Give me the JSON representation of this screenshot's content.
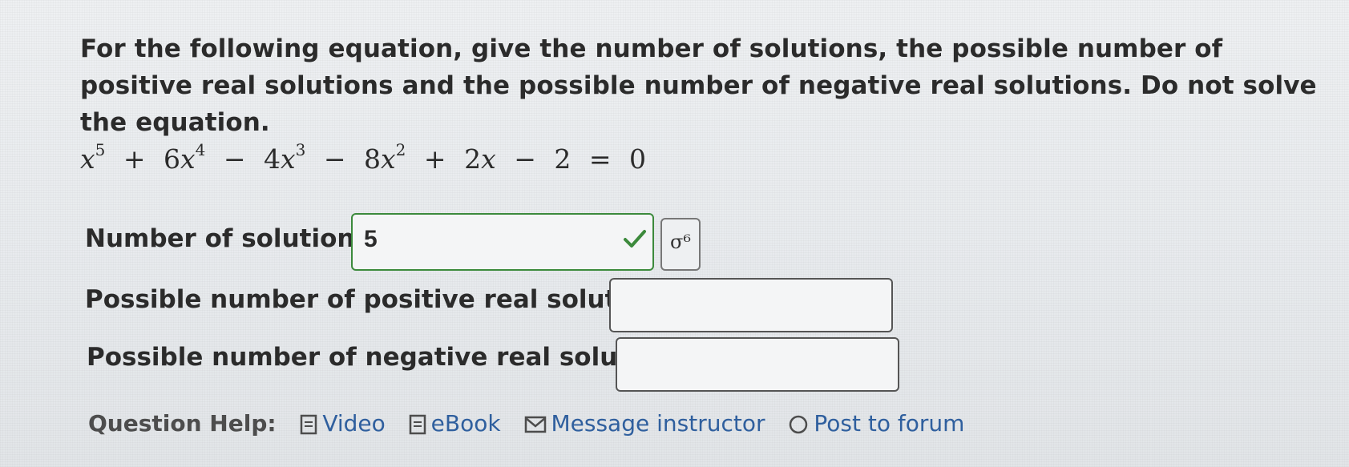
{
  "question": {
    "prompt": "For the following equation, give the number of solutions, the possible number of positive real solutions and the possible number of negative real solutions. Do not solve the equation."
  },
  "equation": {
    "x": "x",
    "exp5": "5",
    "plus1": "+",
    "coef6": "6",
    "exp4": "4",
    "minus1": "−",
    "coef4": "4",
    "exp3": "3",
    "minus2": "−",
    "coef8": "8",
    "exp2": "2",
    "plus2": "+",
    "coef2": "2",
    "minus3": "−",
    "const": "2",
    "equals": "=",
    "rhs": "0"
  },
  "fields": {
    "solutions_label": "Number of solutions:",
    "solutions_value": "5",
    "solutions_status": "correct",
    "positive_label": "Possible number of positive real solutions:",
    "positive_value": "",
    "negative_label": "Possible number of negative real solutions:",
    "negative_value": ""
  },
  "preview_button": {
    "glyph": "σ⁶"
  },
  "help": {
    "label": "Question Help:",
    "video": "Video",
    "ebook": "eBook",
    "message": "Message instructor",
    "forum": "Post to forum"
  },
  "colors": {
    "correct": "#3c8a3c",
    "link": "#2f5f9e"
  }
}
